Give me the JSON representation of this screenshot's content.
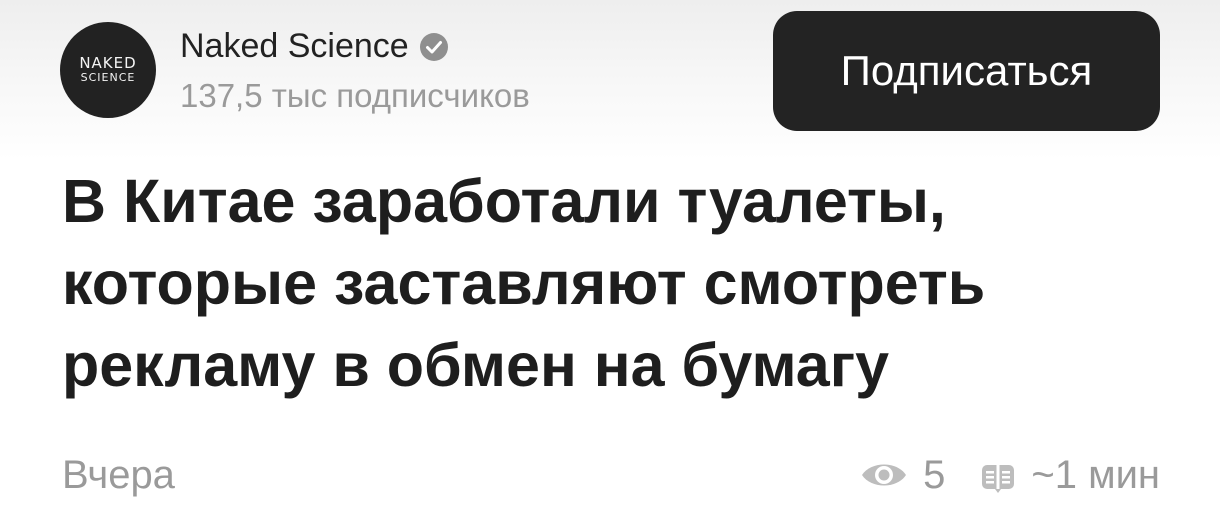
{
  "channel": {
    "avatar_line1": "NAKED",
    "avatar_line2": "SCIENCE",
    "name": "Naked Science",
    "subscribers": "137,5 тыс подписчиков"
  },
  "subscribe_button": {
    "label": "Подписаться"
  },
  "article": {
    "title_lines": [
      "В Китае заработали туалеты,",
      "которые заставляют смотреть",
      "рекламу в обмен на бумагу"
    ],
    "date": "Вчера",
    "views": "5",
    "read_time": "~1 мин"
  },
  "icons": {
    "verified": "check-circle-icon",
    "views": "eye-icon",
    "read_time": "book-icon"
  },
  "colors": {
    "button_bg": "#232323",
    "text_primary": "#1e1e1e",
    "text_secondary": "#9a9a9a"
  }
}
